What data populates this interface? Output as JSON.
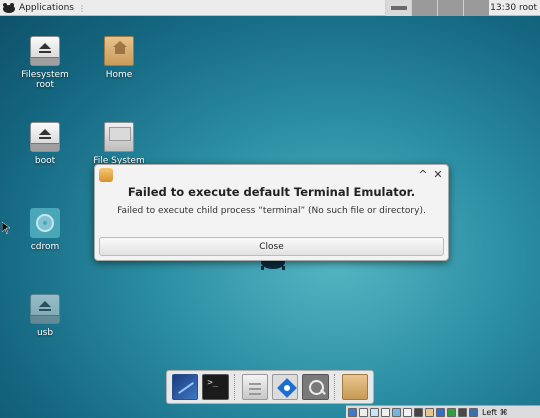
{
  "top_panel": {
    "applications_label": "Applications",
    "menu_separator": "⋮",
    "workspace_count": 4,
    "active_workspace": 1,
    "clock": "13:30 root"
  },
  "desktop": {
    "icons": [
      {
        "label_line1": "Filesystem",
        "label_line2": "root",
        "icon": "drive-icon"
      },
      {
        "label_line1": "Home",
        "icon": "home-folder-icon"
      },
      {
        "label_line1": "boot",
        "icon": "drive-icon"
      },
      {
        "label_line1": "File System",
        "icon": "file-system-icon"
      },
      {
        "label_line1": "cdrom",
        "icon": "cdrom-icon"
      },
      {
        "label_line1": "usb",
        "icon": "drive-icon"
      }
    ]
  },
  "dialog": {
    "min_glyph": "^",
    "close_glyph": "✕",
    "title": "Failed to execute default Terminal Emulator.",
    "message": "Failed to execute child process “terminal” (No such file or directory).",
    "close_button": "Close"
  },
  "dock": {
    "items": [
      "show-desktop-icon",
      "terminal-icon",
      "file-manager-icon",
      "web-browser-icon",
      "app-finder-icon",
      "folder-icon"
    ],
    "terminal_glyph": ">_"
  },
  "tray": {
    "keyboard_layout": "Left ⌘"
  }
}
